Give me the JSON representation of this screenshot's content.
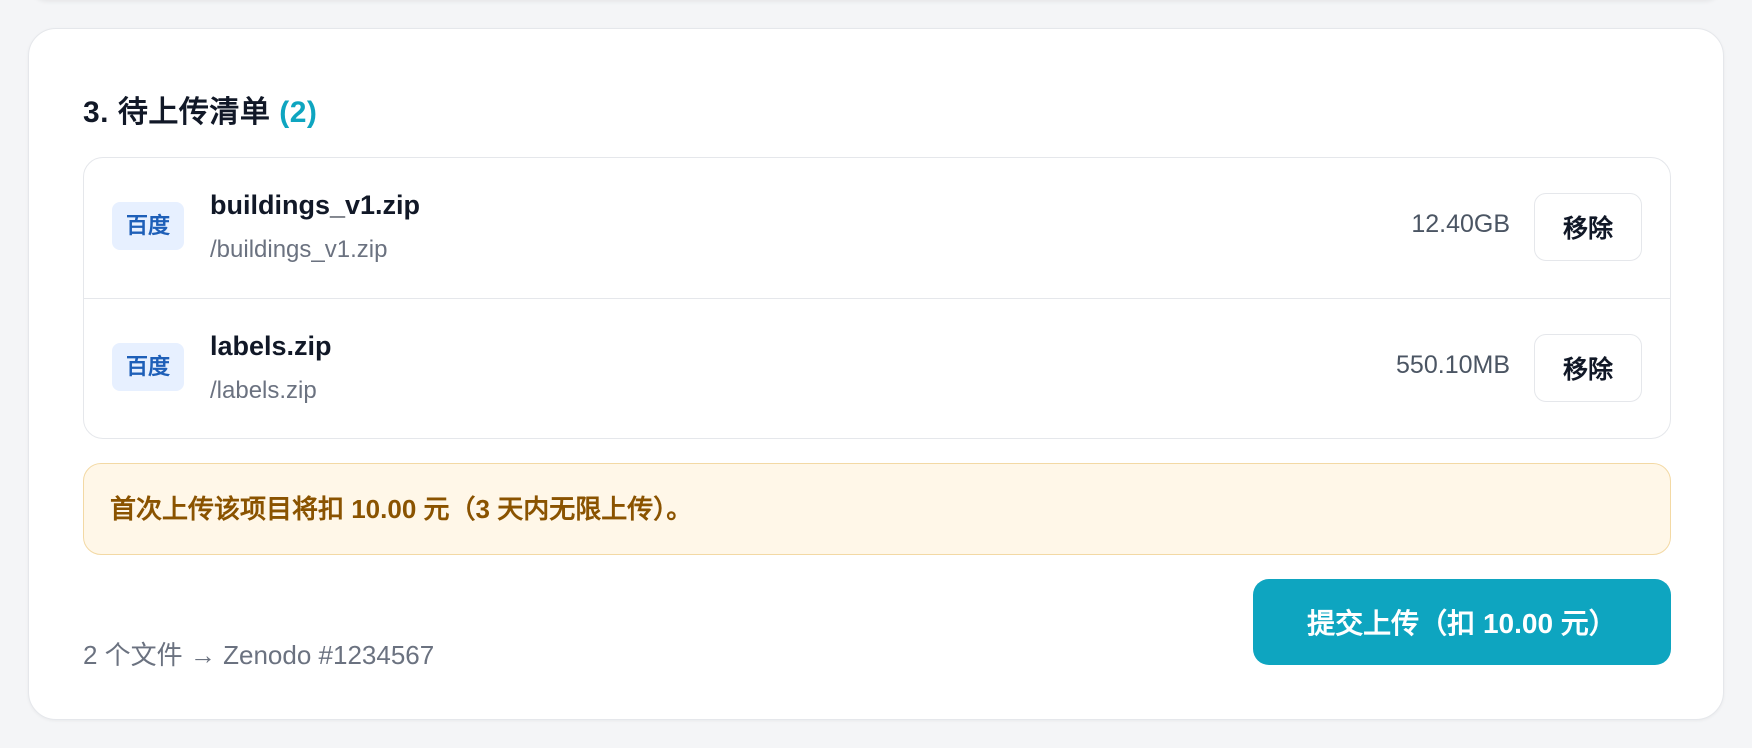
{
  "upload_list": {
    "title": "3. 待上传清单",
    "count_label": "(2)",
    "files": [
      {
        "source": "百度",
        "name": "buildings_v1.zip",
        "path": "/buildings_v1.zip",
        "size": "12.40GB",
        "remove_label": "移除"
      },
      {
        "source": "百度",
        "name": "labels.zip",
        "path": "/labels.zip",
        "size": "550.10MB",
        "remove_label": "移除"
      }
    ],
    "notice": "首次上传该项目将扣 10.00 元（3 天内无限上传）。",
    "summary": "2 个文件 → Zenodo #1234567",
    "submit_label": "提交上传（扣 10.00 元）"
  },
  "colors": {
    "accent": "#0ea5c0",
    "notice_bg": "#fff7e8",
    "notice_text": "#8a5300",
    "badge_bg": "#e7f0ff",
    "badge_text": "#1e5fb8"
  }
}
